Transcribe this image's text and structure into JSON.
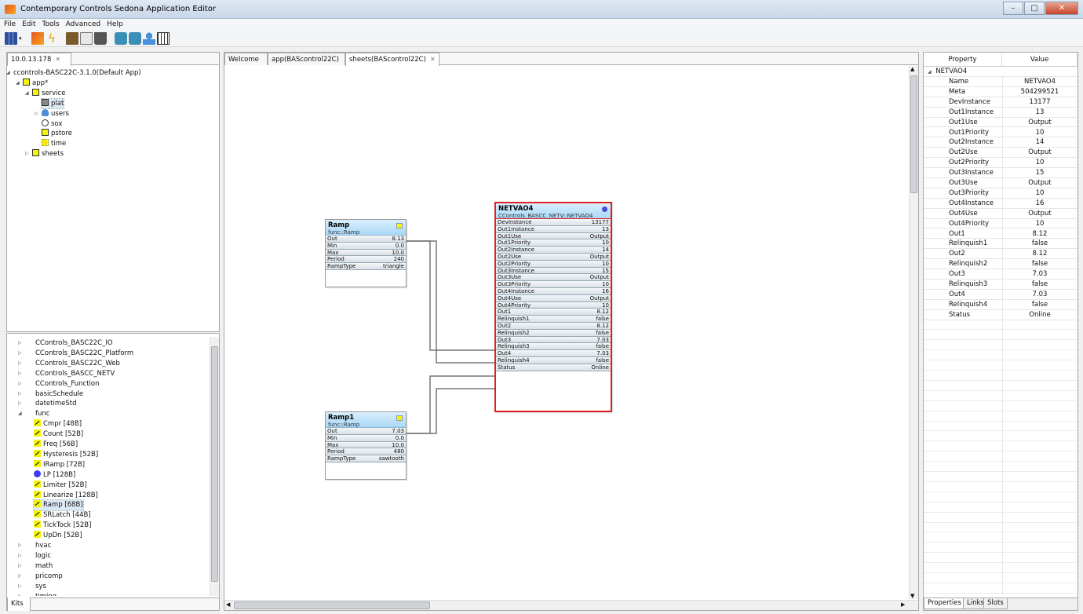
{
  "window": {
    "title": "Contemporary Controls Sedona Application Editor"
  },
  "menu": [
    "File",
    "Edit",
    "Tools",
    "Advanced",
    "Help"
  ],
  "nav": {
    "tab": "10.0.13.178",
    "tree": [
      {
        "label": "ccontrols-BASC22C-3.1.0(Default App)",
        "depth": 0,
        "expander": "open",
        "icon": ""
      },
      {
        "label": "app*",
        "depth": 1,
        "expander": "open",
        "icon": "folder-icon"
      },
      {
        "label": "service",
        "depth": 2,
        "expander": "open",
        "icon": "folder-icon"
      },
      {
        "label": "plat",
        "depth": 3,
        "expander": "",
        "icon": "plat-icon",
        "selected": true
      },
      {
        "label": "users",
        "depth": 3,
        "expander": "closed",
        "icon": "users-icon"
      },
      {
        "label": "sox",
        "depth": 3,
        "expander": "",
        "icon": "sox-icon"
      },
      {
        "label": "pstore",
        "depth": 3,
        "expander": "",
        "icon": "folder-icon"
      },
      {
        "label": "time",
        "depth": 3,
        "expander": "",
        "icon": "time-icon"
      },
      {
        "label": "sheets",
        "depth": 2,
        "expander": "closed",
        "icon": "folder-icon"
      }
    ]
  },
  "kits": {
    "tab": "Kits",
    "items": [
      {
        "label": "CControls_BASC22C_IO",
        "depth": 0,
        "expander": "closed"
      },
      {
        "label": "CControls_BASC22C_Platform",
        "depth": 0,
        "expander": "closed"
      },
      {
        "label": "CControls_BASC22C_Web",
        "depth": 0,
        "expander": "closed"
      },
      {
        "label": "CControls_BASCC_NETV",
        "depth": 0,
        "expander": "closed"
      },
      {
        "label": "CControls_Function",
        "depth": 0,
        "expander": "closed"
      },
      {
        "label": "basicSchedule",
        "depth": 0,
        "expander": "closed"
      },
      {
        "label": "datetimeStd",
        "depth": 0,
        "expander": "closed"
      },
      {
        "label": "func",
        "depth": 0,
        "expander": "open"
      },
      {
        "label": "Cmpr [48B]",
        "depth": 1,
        "icon": "cmpr-icon"
      },
      {
        "label": "Count [52B]",
        "depth": 1,
        "icon": "count-icon"
      },
      {
        "label": "Freq [56B]",
        "depth": 1,
        "icon": "freq-icon"
      },
      {
        "label": "Hysteresis [52B]",
        "depth": 1,
        "icon": "hysteresis-icon"
      },
      {
        "label": "IRamp [72B]",
        "depth": 1,
        "icon": "iramp-icon"
      },
      {
        "label": "LP [128B]",
        "depth": 1,
        "icon": "lp-icon"
      },
      {
        "label": "Limiter [52B]",
        "depth": 1,
        "icon": "limiter-icon"
      },
      {
        "label": "Linearize [128B]",
        "depth": 1,
        "icon": "linearize-icon"
      },
      {
        "label": "Ramp [68B]",
        "depth": 1,
        "icon": "ramp-icon",
        "selected": true
      },
      {
        "label": "SRLatch [44B]",
        "depth": 1,
        "icon": "srlatch-icon"
      },
      {
        "label": "TickTock [52B]",
        "depth": 1,
        "icon": "ticktock-icon"
      },
      {
        "label": "UpDn [52B]",
        "depth": 1,
        "icon": "updn-icon"
      },
      {
        "label": "hvac",
        "depth": 0,
        "expander": "closed"
      },
      {
        "label": "logic",
        "depth": 0,
        "expander": "closed"
      },
      {
        "label": "math",
        "depth": 0,
        "expander": "closed"
      },
      {
        "label": "pricomp",
        "depth": 0,
        "expander": "closed"
      },
      {
        "label": "sys",
        "depth": 0,
        "expander": "closed"
      },
      {
        "label": "timing",
        "depth": 0,
        "expander": "closed"
      }
    ]
  },
  "editor": {
    "tabs": [
      {
        "label": "Welcome",
        "active": false,
        "closable": false
      },
      {
        "label": "app(BAScontrol22C)",
        "active": false,
        "closable": false
      },
      {
        "label": "sheets(BAScontrol22C)",
        "active": true,
        "closable": true
      }
    ],
    "blocks": {
      "ramp": {
        "title": "Ramp",
        "type": "func::Ramp",
        "slots": [
          {
            "name": "Out",
            "value": "8.13"
          },
          {
            "name": "Min",
            "value": "0.0"
          },
          {
            "name": "Max",
            "value": "10.0"
          },
          {
            "name": "Period",
            "value": "240"
          },
          {
            "name": "RampType",
            "value": "triangle"
          }
        ]
      },
      "ramp1": {
        "title": "Ramp1",
        "type": "func::Ramp",
        "slots": [
          {
            "name": "Out",
            "value": "7.03"
          },
          {
            "name": "Min",
            "value": "0.0"
          },
          {
            "name": "Max",
            "value": "10.0"
          },
          {
            "name": "Period",
            "value": "480"
          },
          {
            "name": "RampType",
            "value": "sawtooth"
          }
        ]
      },
      "netvao4": {
        "title": "NETVAO4",
        "type": "CControls_BASCC_NETV::NETVAO4",
        "slots": [
          {
            "name": "DevInstance",
            "value": "13177"
          },
          {
            "name": "Out1Instance",
            "value": "13"
          },
          {
            "name": "Out1Use",
            "value": "Output"
          },
          {
            "name": "Out1Priority",
            "value": "10"
          },
          {
            "name": "Out2Instance",
            "value": "14"
          },
          {
            "name": "Out2Use",
            "value": "Output"
          },
          {
            "name": "Out2Priority",
            "value": "10"
          },
          {
            "name": "Out3Instance",
            "value": "15"
          },
          {
            "name": "Out3Use",
            "value": "Output"
          },
          {
            "name": "Out3Priority",
            "value": "10"
          },
          {
            "name": "Out4Instance",
            "value": "16"
          },
          {
            "name": "Out4Use",
            "value": "Output"
          },
          {
            "name": "Out4Priority",
            "value": "10"
          },
          {
            "name": "Out1",
            "value": "8.12"
          },
          {
            "name": "Relinquish1",
            "value": "false"
          },
          {
            "name": "Out2",
            "value": "8.12"
          },
          {
            "name": "Relinquish2",
            "value": "false"
          },
          {
            "name": "Out3",
            "value": "7.03"
          },
          {
            "name": "Relinquish3",
            "value": "false"
          },
          {
            "name": "Out4",
            "value": "7.03"
          },
          {
            "name": "Relinquish4",
            "value": "false"
          },
          {
            "name": "Status",
            "value": "Online"
          }
        ]
      }
    }
  },
  "properties": {
    "col_property": "Property",
    "col_value": "Value",
    "object": "NETVAO4",
    "rows": [
      {
        "name": "Name",
        "value": "NETVAO4"
      },
      {
        "name": "Meta",
        "value": "504299521"
      },
      {
        "name": "DevInstance",
        "value": "13177"
      },
      {
        "name": "Out1Instance",
        "value": "13"
      },
      {
        "name": "Out1Use",
        "value": "Output"
      },
      {
        "name": "Out1Priority",
        "value": "10"
      },
      {
        "name": "Out2Instance",
        "value": "14"
      },
      {
        "name": "Out2Use",
        "value": "Output"
      },
      {
        "name": "Out2Priority",
        "value": "10"
      },
      {
        "name": "Out3Instance",
        "value": "15"
      },
      {
        "name": "Out3Use",
        "value": "Output"
      },
      {
        "name": "Out3Priority",
        "value": "10"
      },
      {
        "name": "Out4Instance",
        "value": "16"
      },
      {
        "name": "Out4Use",
        "value": "Output"
      },
      {
        "name": "Out4Priority",
        "value": "10"
      },
      {
        "name": "Out1",
        "value": "8.12"
      },
      {
        "name": "Relinquish1",
        "value": "false"
      },
      {
        "name": "Out2",
        "value": "8.12"
      },
      {
        "name": "Relinquish2",
        "value": "false"
      },
      {
        "name": "Out3",
        "value": "7.03"
      },
      {
        "name": "Relinquish3",
        "value": "false"
      },
      {
        "name": "Out4",
        "value": "7.03"
      },
      {
        "name": "Relinquish4",
        "value": "false"
      },
      {
        "name": "Status",
        "value": "Online"
      }
    ],
    "bottom_tabs": [
      "Properties",
      "Links",
      "Slots"
    ]
  },
  "colors": {
    "accent_block": "#a9d8f5",
    "selected_outline": "#e02020",
    "wire": "#777777"
  }
}
